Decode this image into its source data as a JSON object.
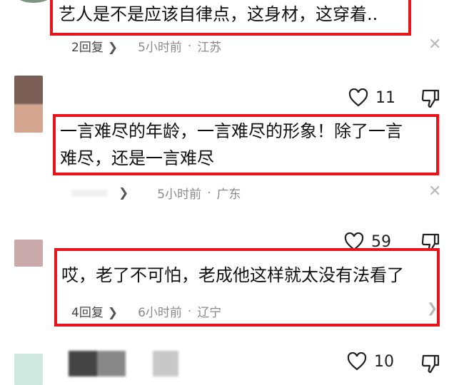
{
  "comments": [
    {
      "text_lines": [
        "艺人是不是应该自律点，这身材，这穿着.."
      ],
      "reply_label": "2回复",
      "time": "5小时前",
      "location": "江苏",
      "likes": ""
    },
    {
      "text_lines": [
        "一言难尽的年龄，一言难尽的形象！除了一言",
        "难尽，还是一言难尽"
      ],
      "reply_label": "",
      "time": "5小时前",
      "location": "广东",
      "likes": "11"
    },
    {
      "text_lines": [
        "哎，老了不可怕，老成他这样就太没有法看了"
      ],
      "reply_label": "4回复",
      "time": "6小时前",
      "location": "辽宁",
      "likes": "59"
    },
    {
      "text_lines": [],
      "reply_label": "",
      "time": "",
      "location": "",
      "likes": "10"
    }
  ],
  "icons": {
    "like": "heart-outline-icon",
    "dislike": "thumb-down-icon",
    "close": "close-icon",
    "chevron": "chevron-right-icon"
  },
  "colors": {
    "highlight": "#e8131b",
    "meta": "#8a8a8a"
  }
}
